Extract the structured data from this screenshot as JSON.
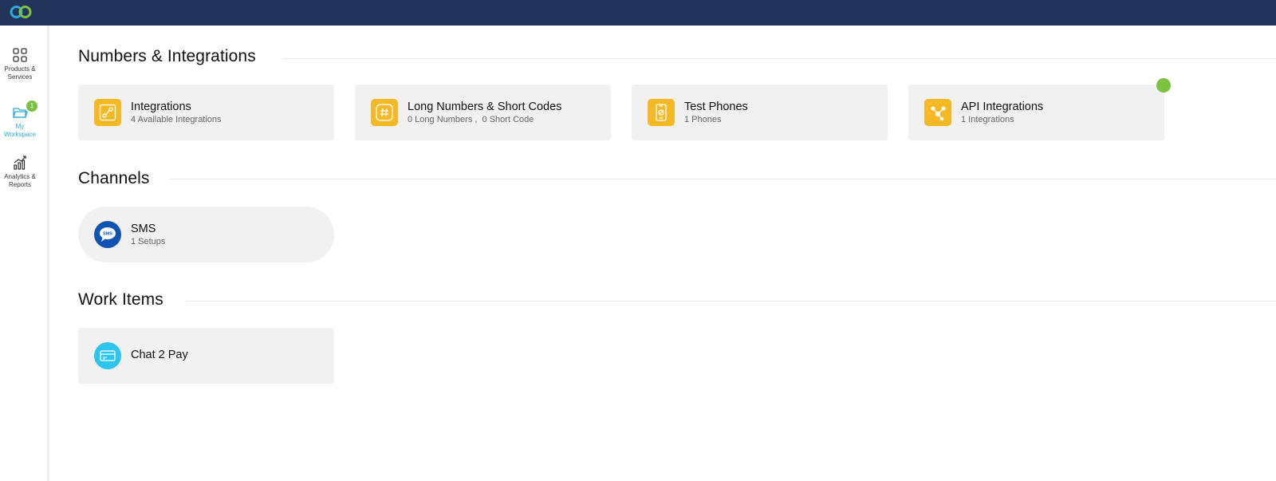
{
  "sidebar": {
    "items": [
      {
        "label_line1": "Products &",
        "label_line2": "Services",
        "icon": "grid-icon"
      },
      {
        "label_line1": "My Workspace",
        "label_line2": "",
        "icon": "folder-icon",
        "badge": "1"
      },
      {
        "label_line1": "Analytics &",
        "label_line2": "Reports",
        "icon": "bar-chart-icon"
      }
    ]
  },
  "sections": {
    "numbers": {
      "title": "Numbers & Integrations",
      "cards": [
        {
          "title": "Integrations",
          "sub": "4 Available Integrations",
          "icon": "integration-icon"
        },
        {
          "title": "Long Numbers & Short Codes",
          "sub": "0 Long Numbers ,  0 Short Code",
          "icon": "hash-icon"
        },
        {
          "title": "Test Phones",
          "sub": "1 Phones",
          "icon": "phone-icon"
        },
        {
          "title": "API Integrations",
          "sub": "1 Integrations",
          "icon": "share-icon"
        }
      ]
    },
    "channels": {
      "title": "Channels",
      "cards": [
        {
          "title": "SMS",
          "sub": "1 Setups",
          "icon": "sms-icon",
          "icon_text": "SMS"
        }
      ]
    },
    "work_items": {
      "title": "Work Items",
      "cards": [
        {
          "title": "Chat 2 Pay",
          "icon": "card-payment-icon"
        }
      ]
    }
  },
  "colors": {
    "topbar": "#23345a",
    "accent_yellow": "#f6b926",
    "sms_blue": "#1054b3",
    "chat_cyan": "#2ec4ee",
    "status_green": "#7cc242",
    "active_blue": "#2fa9d9"
  }
}
